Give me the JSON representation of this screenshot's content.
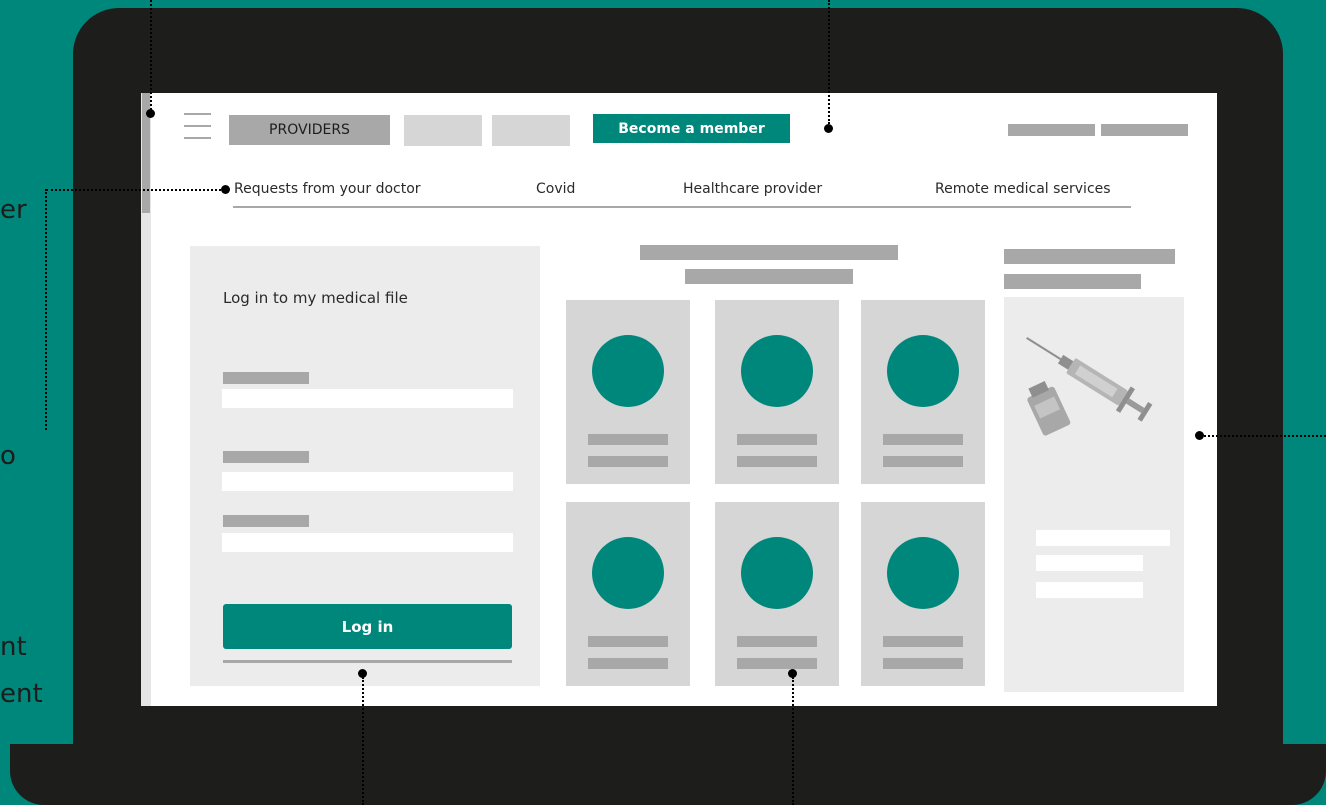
{
  "header": {
    "providers_label": "PROVIDERS",
    "cta_label": "Become a member"
  },
  "tabs": [
    {
      "label": "Requests from your doctor"
    },
    {
      "label": "Covid"
    },
    {
      "label": "Healthcare provider"
    },
    {
      "label": "Remote medical services"
    }
  ],
  "login": {
    "title": "Log in to my medical file",
    "button_label": "Log in"
  },
  "cards": [
    {
      "icon": "circle-placeholder"
    },
    {
      "icon": "circle-placeholder"
    },
    {
      "icon": "circle-placeholder"
    },
    {
      "icon": "circle-placeholder"
    },
    {
      "icon": "circle-placeholder"
    },
    {
      "icon": "circle-placeholder"
    }
  ],
  "side_fragments": [
    "er",
    "o",
    "nt",
    "ent"
  ],
  "colors": {
    "background": "#00877b",
    "accent": "#00877b",
    "laptop": "#1d1d1b",
    "placeholder": "#a8a8a8",
    "light_placeholder": "#d6d6d6",
    "panel": "#ececec"
  },
  "side_panel": {
    "illustration": "syringe-and-vial-icon"
  }
}
